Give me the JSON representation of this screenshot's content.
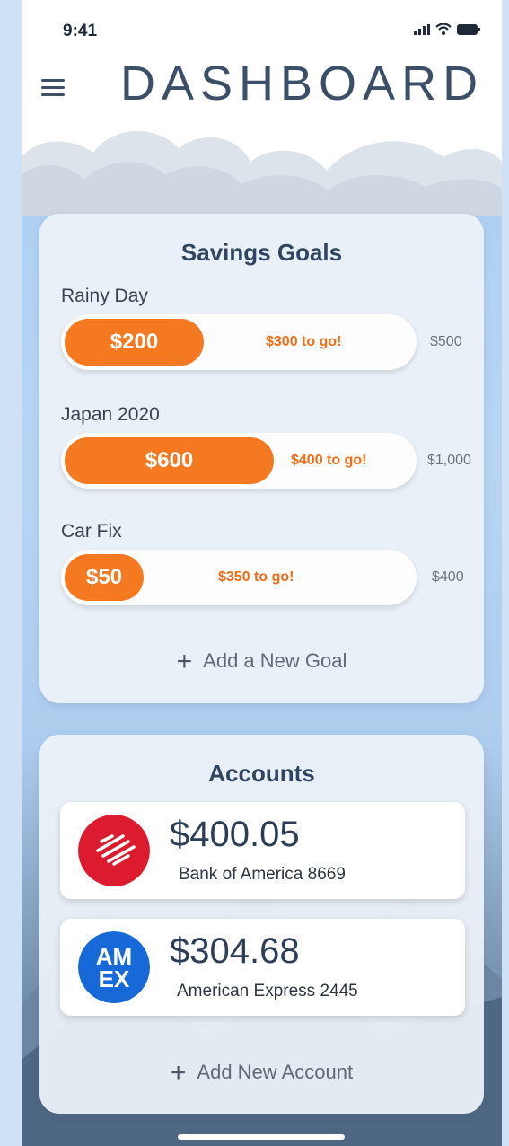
{
  "status_bar": {
    "time": "9:41"
  },
  "header": {
    "title": "DASHBOARD"
  },
  "savings": {
    "heading": "Savings Goals",
    "goals": [
      {
        "label": "Rainy Day",
        "saved": "$200",
        "to_go": "$300 to go!",
        "target": "$500",
        "progress": 0.4
      },
      {
        "label": "Japan 2020",
        "saved": "$600",
        "to_go": "$400 to go!",
        "target": "$1,000",
        "progress": 0.6
      },
      {
        "label": "Car Fix",
        "saved": "$50",
        "to_go": "$350 to go!",
        "target": "$400",
        "progress": 0.125
      }
    ],
    "add_label": "Add a New Goal"
  },
  "accounts": {
    "heading": "Accounts",
    "items": [
      {
        "amount": "$400.05",
        "name": "Bank of America 8669",
        "logo": "bank-of-america-logo"
      },
      {
        "amount": "$304.68",
        "name": "American Express 2445",
        "logo": "amex-logo",
        "logo_text_1": "AM",
        "logo_text_2": "EX"
      }
    ],
    "add_label": "Add New Account"
  },
  "colors": {
    "accent": "#f47920",
    "title": "#3b5068"
  }
}
